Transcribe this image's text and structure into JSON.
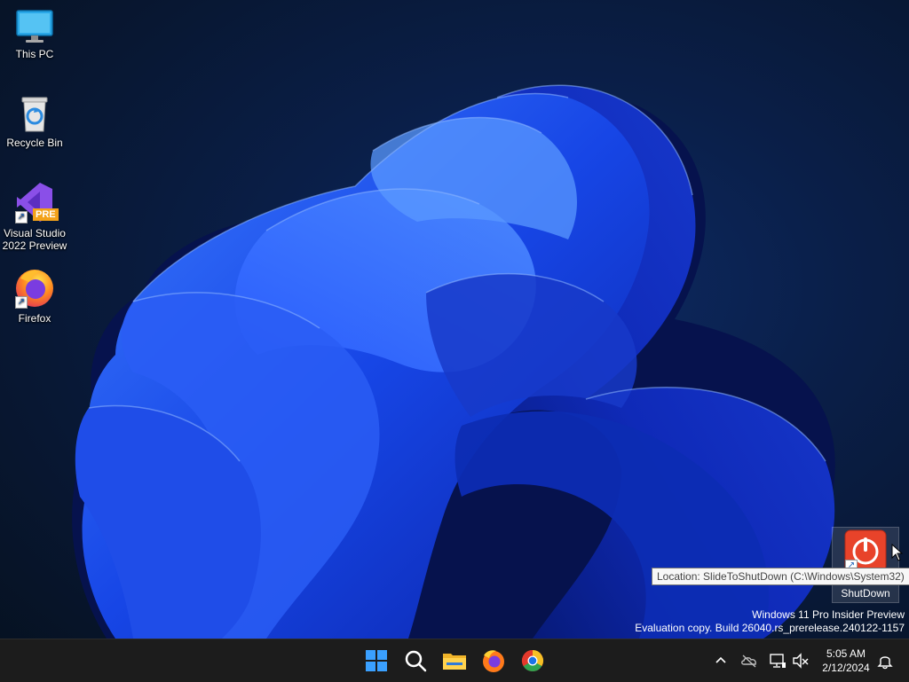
{
  "desktop": {
    "icons": [
      {
        "label": "This PC",
        "icon": "monitor-icon"
      },
      {
        "label": "Recycle Bin",
        "icon": "recycle-bin-icon"
      },
      {
        "label": "Visual Studio 2022 Preview",
        "icon": "visual-studio-icon",
        "badge": "PRE"
      },
      {
        "label": "Firefox",
        "icon": "firefox-icon"
      }
    ],
    "shutdown_shortcut": {
      "label": "ShutDown",
      "icon": "power-icon"
    },
    "tooltip": "Location: SlideToShutDown (C:\\Windows\\System32)"
  },
  "watermark": {
    "line1": "Windows 11 Pro Insider Preview",
    "line2": "Evaluation copy. Build 26040.rs_prerelease.240122-1157"
  },
  "taskbar": {
    "pinned": [
      "start-icon",
      "search-icon",
      "file-explorer-icon",
      "firefox-icon",
      "chrome-icon"
    ],
    "tray_icons": [
      "chevron-up-icon",
      "onedrive-icon",
      "network-icon",
      "speaker-muted-icon"
    ],
    "time": "5:05 AM",
    "date": "2/12/2024",
    "notification_icon": "bell-icon"
  },
  "colors": {
    "taskbar_bg": "#1c1c1c",
    "accent_blue": "#1a55f0",
    "start_blue": "#3aa0ff"
  }
}
